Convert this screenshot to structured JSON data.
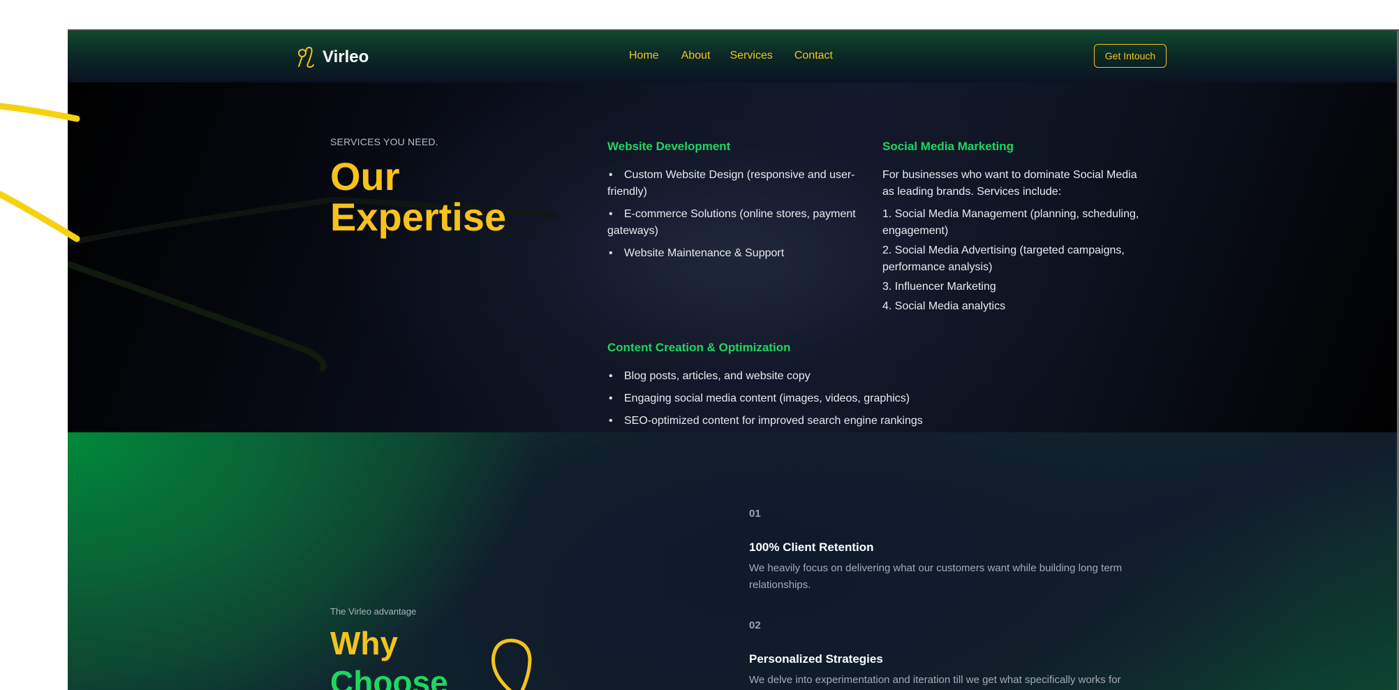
{
  "nav": {
    "brand": "Virleo",
    "links": [
      "Home",
      "About",
      "Services",
      "Contact"
    ],
    "cta": "Get Intouch"
  },
  "services": {
    "kicker": "SERVICES YOU NEED.",
    "title_line1": "Our",
    "title_line2": "Expertise",
    "web": {
      "title": "Website Development",
      "items": [
        "Custom Website Design (responsive and user-friendly)",
        "E-commerce Solutions (online stores, payment gateways)",
        "Website Maintenance & Support"
      ]
    },
    "social": {
      "title": "Social Media Marketing",
      "intro": "For businesses who want to dominate Social Media as leading brands. Services include:",
      "items": [
        "1. Social Media Management (planning, scheduling, engagement)",
        "2. Social Media Advertising (targeted campaigns, performance analysis)",
        "3. Influencer Marketing",
        "4. Social Media analytics"
      ]
    },
    "content": {
      "title": "Content Creation & Optimization",
      "items": [
        "Blog posts, articles, and website copy",
        "Engaging social media content (images, videos, graphics)",
        "SEO-optimized content for improved search engine rankings"
      ]
    }
  },
  "why": {
    "kicker": "The Virleo advantage",
    "title_line1": "Why",
    "title_line2": "Choose",
    "features": [
      {
        "num": "01",
        "title": "100% Client Retention",
        "desc": "We heavily focus on delivering what our customers want while building long term relationships."
      },
      {
        "num": "02",
        "title": "Personalized Strategies",
        "desc": "We delve into experimentation and iteration till we get what specifically works for you giving you a unique brand image."
      }
    ]
  },
  "colors": {
    "accent_yellow": "#f6c21b",
    "accent_green": "#1ed760",
    "dark_bg": "#0b0f1c"
  },
  "icons": [
    "leo-logo-icon",
    "bullet-icon",
    "swirl-decoration"
  ]
}
